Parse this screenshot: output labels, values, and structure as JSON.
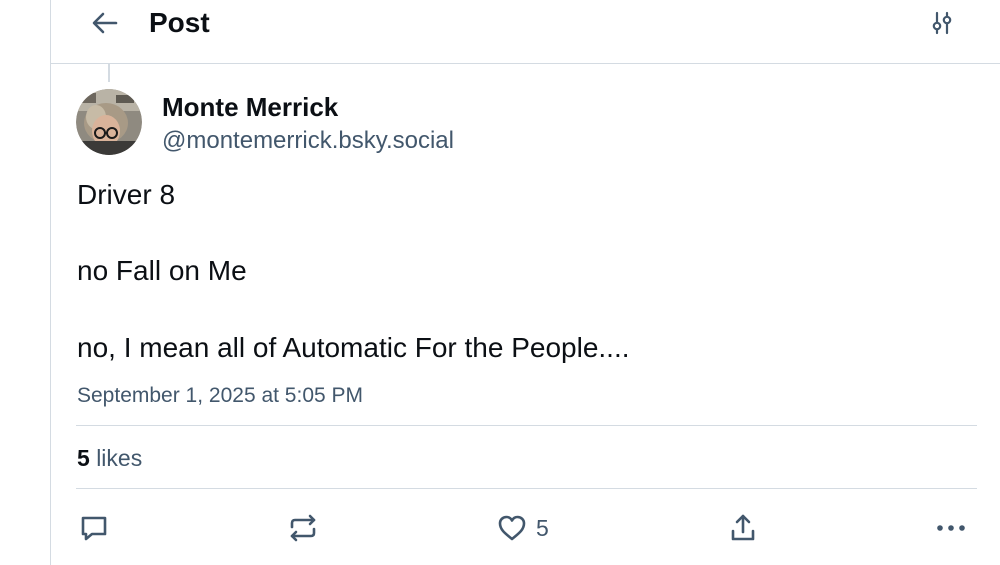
{
  "header": {
    "title": "Post",
    "back_icon": "arrow-left-icon",
    "filter_icon": "sliders-icon"
  },
  "post": {
    "author": {
      "display_name": "Monte Merrick",
      "handle": "@montemerrick.bsky.social"
    },
    "paragraphs": [
      "Driver 8",
      "no Fall on Me",
      "no, I mean all of Automatic For the People...."
    ],
    "timestamp": "September 1, 2025 at 5:05 PM",
    "likes": {
      "count": "5",
      "label": "likes"
    },
    "actions": {
      "reply_icon": "comment-icon",
      "repost_icon": "repost-icon",
      "like_icon": "heart-icon",
      "like_count": "5",
      "share_icon": "share-icon",
      "more_icon": "more-icon"
    }
  },
  "colors": {
    "text": "#0b0f14",
    "muted": "#42576c",
    "divider": "#d4dbe2",
    "icon": "#42576c"
  }
}
